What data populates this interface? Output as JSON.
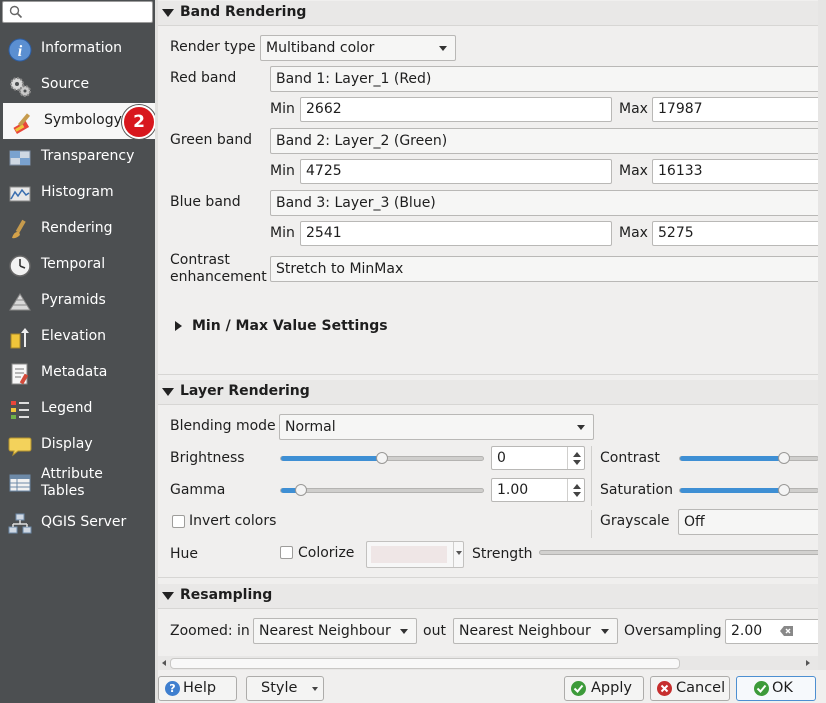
{
  "sidebar": {
    "search_placeholder": "",
    "items": [
      {
        "label": "Information",
        "icon": "info-icon"
      },
      {
        "label": "Source",
        "icon": "source-gears-icon"
      },
      {
        "label": "Symbology",
        "icon": "paintbrush-icon"
      },
      {
        "label": "Transparency",
        "icon": "transparency-icon"
      },
      {
        "label": "Histogram",
        "icon": "histogram-icon"
      },
      {
        "label": "Rendering",
        "icon": "brush-icon"
      },
      {
        "label": "Temporal",
        "icon": "clock-icon"
      },
      {
        "label": "Pyramids",
        "icon": "pyramids-icon"
      },
      {
        "label": "Elevation",
        "icon": "elevation-icon"
      },
      {
        "label": "Metadata",
        "icon": "metadata-icon"
      },
      {
        "label": "Legend",
        "icon": "legend-icon"
      },
      {
        "label": "Display",
        "icon": "speech-bubble-icon"
      },
      {
        "label": "Attribute Tables",
        "icon": "table-icon"
      },
      {
        "label": "QGIS Server",
        "icon": "server-icon"
      }
    ],
    "active_item": "Symbology",
    "badge": "2"
  },
  "band_rendering": {
    "title": "Band Rendering",
    "render_type_label": "Render type",
    "render_type_value": "Multiband color",
    "red_band_label": "Red band",
    "red_band_value": "Band 1: Layer_1 (Red)",
    "green_band_label": "Green band",
    "green_band_value": "Band 2: Layer_2 (Green)",
    "blue_band_label": "Blue band",
    "blue_band_value": "Band 3: Layer_3 (Blue)",
    "min_label": "Min",
    "max_label": "Max",
    "red_min": "2662",
    "red_max": "17987",
    "green_min": "4725",
    "green_max": "16133",
    "blue_min": "2541",
    "blue_max": "5275",
    "contrast_label_1": "Contrast",
    "contrast_label_2": "enhancement",
    "contrast_value": "Stretch to MinMax",
    "minmax_settings": "Min / Max Value Settings"
  },
  "layer_rendering": {
    "title": "Layer Rendering",
    "blending_label": "Blending mode",
    "blending_value": "Normal",
    "brightness_label": "Brightness",
    "brightness_value": "0",
    "brightness_level": 0.5,
    "contrast_label": "Contrast",
    "contrast_level": 0.75,
    "gamma_label": "Gamma",
    "gamma_value": "1.00",
    "gamma_level": 0.1,
    "saturation_label": "Saturation",
    "saturation_level": 0.75,
    "invert_label": "Invert colors",
    "grayscale_label": "Grayscale",
    "grayscale_value": "Off",
    "hue_label": "Hue",
    "colorize_label": "Colorize",
    "strength_label": "Strength",
    "colorize_color": "#efe6e6"
  },
  "resampling": {
    "title": "Resampling",
    "zoomed_in_label": "Zoomed: in",
    "zoomed_in_value": "Nearest Neighbour",
    "out_label": "out",
    "zoomed_out_value": "Nearest Neighbour",
    "oversampling_label": "Oversampling",
    "oversampling_value": "2.00"
  },
  "buttons": {
    "help": "Help",
    "style": "Style",
    "apply": "Apply",
    "cancel": "Cancel",
    "ok": "OK"
  },
  "colors": {
    "sidebar_bg": "#4c4f51",
    "accent": "#3e8fd4",
    "badge": "#d8171d"
  }
}
